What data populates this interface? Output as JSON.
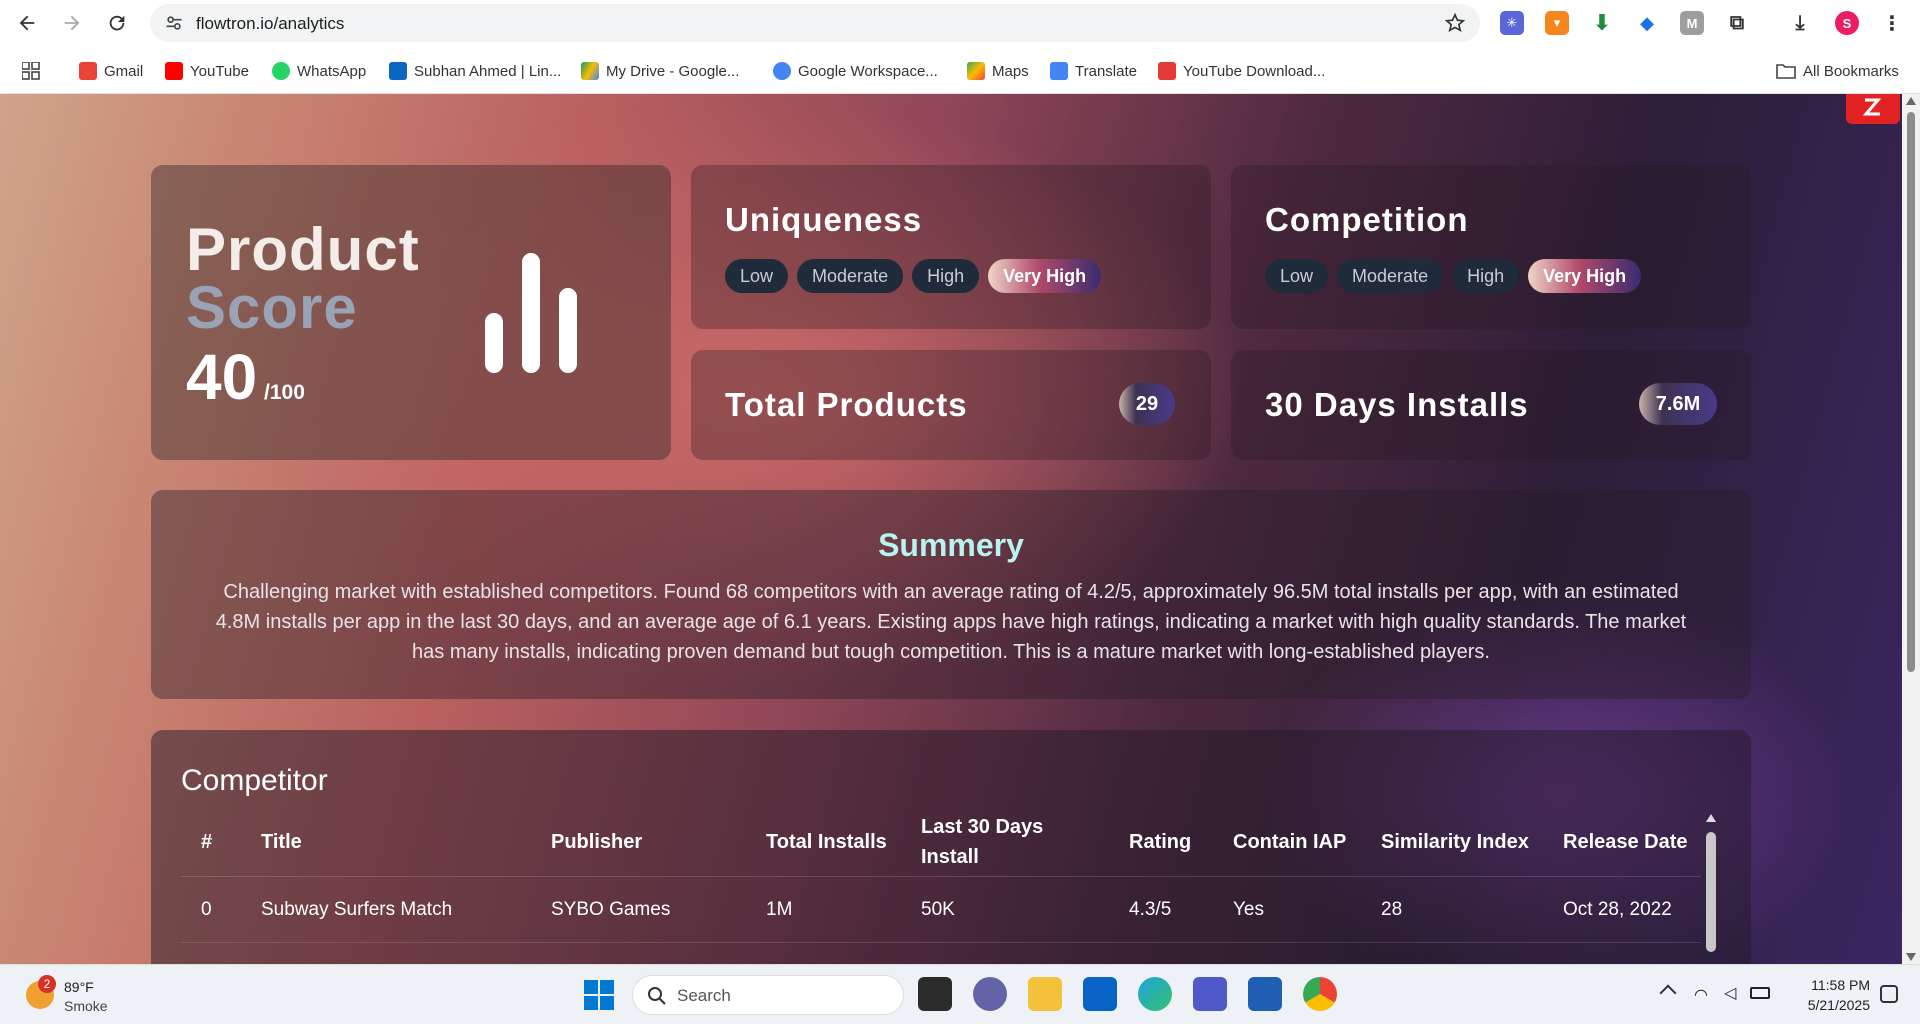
{
  "browser": {
    "url": "flowtron.io/analytics",
    "bookmarks": [
      {
        "label": "Gmail",
        "icon": "gmail-icon",
        "color": "#ea4335"
      },
      {
        "label": "YouTube",
        "icon": "youtube-icon",
        "color": "#ff0000"
      },
      {
        "label": "WhatsApp",
        "icon": "whatsapp-icon",
        "color": "#25d366"
      },
      {
        "label": "Subhan Ahmed | Lin...",
        "icon": "linkedin-icon",
        "color": "#0a66c2"
      },
      {
        "label": "My Drive - Google...",
        "icon": "google-drive-icon",
        "color": "#fbbc04"
      },
      {
        "label": "Google Workspace...",
        "icon": "google-workspace-icon",
        "color": "#4285f4"
      },
      {
        "label": "Maps",
        "icon": "maps-icon",
        "color": "#34a853"
      },
      {
        "label": "Translate",
        "icon": "translate-icon",
        "color": "#4285f4"
      },
      {
        "label": "YouTube Download...",
        "icon": "download-icon",
        "color": "#e53935"
      }
    ],
    "all_bookmarks": "All Bookmarks",
    "profile_initial": "S"
  },
  "score": {
    "line1": "Product",
    "line2": "Score",
    "value": "40",
    "denominator": "/100"
  },
  "uniqueness": {
    "title": "Uniqueness",
    "levels": [
      "Low",
      "Moderate",
      "High",
      "Very High"
    ],
    "selected": "Very High"
  },
  "competition": {
    "title": "Competition",
    "levels": [
      "Low",
      "Moderate",
      "High",
      "Very High"
    ],
    "selected": "Very High"
  },
  "total_products": {
    "title": "Total Products",
    "value": "29"
  },
  "installs_30d": {
    "title": "30 Days Installs",
    "value": "7.6M"
  },
  "summary": {
    "title": "Summery",
    "text": "Challenging market with established competitors. Found 68 competitors with an average rating of 4.2/5, approximately 96.5M total installs per app, with an estimated 4.8M installs per app in the last 30 days, and an average age of 6.1 years. Existing apps have high ratings, indicating a market with high quality standards. The market has many installs, indicating proven demand but tough competition. This is a mature market with long-established players."
  },
  "competitor": {
    "title": "Competitor",
    "columns": [
      "#",
      "Title",
      "Publisher",
      "Total Installs",
      "Last 30 Days Install",
      "Rating",
      "Contain IAP",
      "Similarity Index",
      "Release Date"
    ],
    "rows": [
      [
        "0",
        "Subway Surfers Match",
        "SYBO Games",
        "1M",
        "50K",
        "4.3/5",
        "Yes",
        "28",
        "Oct 28, 2022"
      ]
    ]
  },
  "taskbar": {
    "notification_count": "2",
    "temperature": "89°F",
    "condition": "Smoke",
    "search_placeholder": "Search",
    "time": "11:58 PM",
    "date": "5/21/2025"
  }
}
